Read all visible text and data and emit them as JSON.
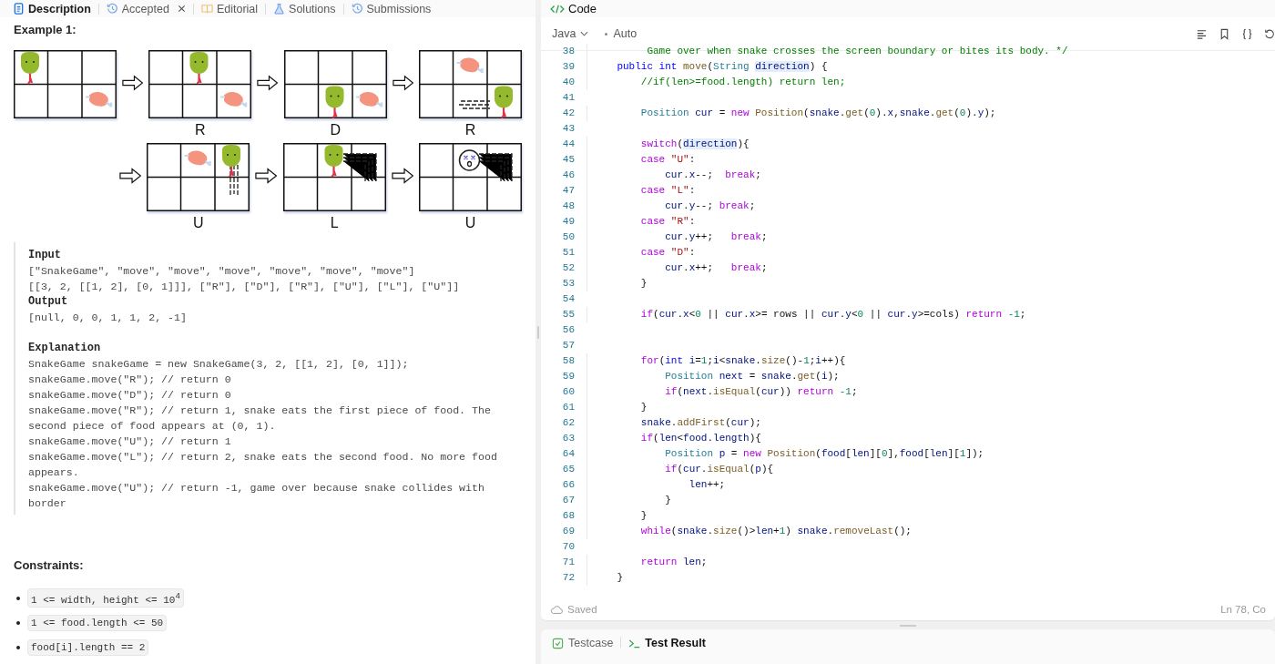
{
  "tabs": [
    {
      "label": "Description",
      "selected": true,
      "closable": false
    },
    {
      "label": "Accepted",
      "selected": false,
      "closable": true
    },
    {
      "label": "Editorial",
      "selected": false,
      "closable": false
    },
    {
      "label": "Solutions",
      "selected": false,
      "closable": false
    },
    {
      "label": "Submissions",
      "selected": false,
      "closable": false
    }
  ],
  "example": {
    "title": "Example 1:",
    "moves": [
      "R",
      "D",
      "R",
      "U",
      "L",
      "U"
    ],
    "blocks": [
      {
        "kind": "heading",
        "text": "Input"
      },
      {
        "kind": "line",
        "text": "[\"SnakeGame\", \"move\", \"move\", \"move\", \"move\", \"move\", \"move\"]"
      },
      {
        "kind": "line",
        "text": "[[3, 2, [[1, 2], [0, 1]]], [\"R\"], [\"D\"], [\"R\"], [\"U\"], [\"L\"], [\"U\"]]"
      },
      {
        "kind": "heading",
        "text": "Output"
      },
      {
        "kind": "line",
        "text": "[null, 0, 0, 1, 1, 2, -1]"
      },
      {
        "kind": "gap"
      },
      {
        "kind": "heading",
        "text": "Explanation"
      },
      {
        "kind": "line",
        "text": "SnakeGame snakeGame = new SnakeGame(3, 2, [[1, 2], [0, 1]]);"
      },
      {
        "kind": "line",
        "text": "snakeGame.move(\"R\"); // return 0"
      },
      {
        "kind": "line",
        "text": "snakeGame.move(\"D\"); // return 0"
      },
      {
        "kind": "line",
        "text": "snakeGame.move(\"R\"); // return 1, snake eats the first piece of food. The second piece of food appears at (0, 1)."
      },
      {
        "kind": "line",
        "text": "snakeGame.move(\"U\"); // return 1"
      },
      {
        "kind": "line",
        "text": "snakeGame.move(\"L\"); // return 2, snake eats the second food. No more food appears."
      },
      {
        "kind": "line",
        "text": "snakeGame.move(\"U\"); // return -1, game over because snake collides with border"
      }
    ]
  },
  "constraints": {
    "title": "Constraints:",
    "items": [
      "1 <= width, height <= 10$^{4}$",
      "1 <= food.length <= 50",
      "food[i].length == 2"
    ]
  },
  "editor": {
    "title": "Code",
    "language": "Java",
    "mode": "Auto",
    "status": "Saved",
    "position": "Ln 78, Co",
    "lines": [
      {
        "n": "38",
        "tokens": [
          {
            "kind": "cmt",
            "text": "         Game over when snake crosses the screen boundary or bites its body. */"
          }
        ]
      },
      {
        "n": "39",
        "tokens": [
          {
            "kind": "decl",
            "text": "    public"
          },
          {
            "kind": "decl",
            "text": " int"
          },
          {
            "kind": "fn",
            "text": " move"
          },
          {
            "kind": "plain",
            "text": "("
          },
          {
            "kind": "type",
            "text": "String "
          },
          {
            "kind": "hl",
            "text": "direction"
          },
          {
            "kind": "plain",
            "text": ") {"
          }
        ]
      },
      {
        "n": "40",
        "tokens": [
          {
            "kind": "cmt",
            "text": "        //if(len>=food.length) return len;"
          }
        ]
      },
      {
        "n": "41"
      },
      {
        "n": "42",
        "tokens": [
          {
            "kind": "type",
            "text": "        Position"
          },
          {
            "kind": "var",
            "text": " cur"
          },
          {
            "kind": "plain",
            "text": " = "
          },
          {
            "kind": "kw",
            "text": "new"
          },
          {
            "kind": "fn",
            "text": " Position"
          },
          {
            "kind": "plain",
            "text": "("
          },
          {
            "kind": "var",
            "text": "snake"
          },
          {
            "kind": "plain",
            "text": "."
          },
          {
            "kind": "fn",
            "text": "get"
          },
          {
            "kind": "plain",
            "text": "("
          },
          {
            "kind": "num",
            "text": "0"
          },
          {
            "kind": "plain",
            "text": ")."
          },
          {
            "kind": "var",
            "text": "x"
          },
          {
            "kind": "plain",
            "text": ","
          },
          {
            "kind": "var",
            "text": "snake"
          },
          {
            "kind": "plain",
            "text": "."
          },
          {
            "kind": "fn",
            "text": "get"
          },
          {
            "kind": "plain",
            "text": "("
          },
          {
            "kind": "num",
            "text": "0"
          },
          {
            "kind": "plain",
            "text": ")."
          },
          {
            "kind": "var",
            "text": "y"
          },
          {
            "kind": "plain",
            "text": ");"
          }
        ]
      },
      {
        "n": "43"
      },
      {
        "n": "44",
        "tokens": [
          {
            "kind": "kw",
            "text": "        switch"
          },
          {
            "kind": "plain",
            "text": "("
          },
          {
            "kind": "hl",
            "text": "direction"
          },
          {
            "kind": "plain",
            "text": "){"
          }
        ]
      },
      {
        "n": "45",
        "tokens": [
          {
            "kind": "kw",
            "text": "        case"
          },
          {
            "kind": "str",
            "text": " \"U\""
          },
          {
            "kind": "plain",
            "text": ":"
          }
        ]
      },
      {
        "n": "46",
        "tokens": [
          {
            "kind": "var",
            "text": "            cur"
          },
          {
            "kind": "plain",
            "text": "."
          },
          {
            "kind": "var",
            "text": "x"
          },
          {
            "kind": "plain",
            "text": "--;"
          },
          {
            "kind": "kw",
            "text": "  break"
          },
          {
            "kind": "plain",
            "text": ";"
          }
        ]
      },
      {
        "n": "47",
        "tokens": [
          {
            "kind": "kw",
            "text": "        case"
          },
          {
            "kind": "str",
            "text": " \"L\""
          },
          {
            "kind": "plain",
            "text": ":"
          }
        ]
      },
      {
        "n": "48",
        "tokens": [
          {
            "kind": "var",
            "text": "            cur"
          },
          {
            "kind": "plain",
            "text": "."
          },
          {
            "kind": "var",
            "text": "y"
          },
          {
            "kind": "plain",
            "text": "--;"
          },
          {
            "kind": "kw",
            "text": " break"
          },
          {
            "kind": "plain",
            "text": ";"
          }
        ]
      },
      {
        "n": "49",
        "tokens": [
          {
            "kind": "kw",
            "text": "        case"
          },
          {
            "kind": "str",
            "text": " \"R\""
          },
          {
            "kind": "plain",
            "text": ":"
          }
        ]
      },
      {
        "n": "50",
        "tokens": [
          {
            "kind": "var",
            "text": "            cur"
          },
          {
            "kind": "plain",
            "text": "."
          },
          {
            "kind": "var",
            "text": "y"
          },
          {
            "kind": "plain",
            "text": "++;"
          },
          {
            "kind": "kw",
            "text": "   break"
          },
          {
            "kind": "plain",
            "text": ";"
          }
        ]
      },
      {
        "n": "51",
        "tokens": [
          {
            "kind": "kw",
            "text": "        case"
          },
          {
            "kind": "str",
            "text": " \"D\""
          },
          {
            "kind": "plain",
            "text": ":"
          }
        ]
      },
      {
        "n": "52",
        "tokens": [
          {
            "kind": "var",
            "text": "            cur"
          },
          {
            "kind": "plain",
            "text": "."
          },
          {
            "kind": "var",
            "text": "x"
          },
          {
            "kind": "plain",
            "text": "++;"
          },
          {
            "kind": "kw",
            "text": "   break"
          },
          {
            "kind": "plain",
            "text": ";"
          }
        ]
      },
      {
        "n": "53",
        "tokens": [
          {
            "kind": "plain",
            "text": "        }"
          }
        ]
      },
      {
        "n": "54"
      },
      {
        "n": "55",
        "tokens": [
          {
            "kind": "kw",
            "text": "        if"
          },
          {
            "kind": "plain",
            "text": "("
          },
          {
            "kind": "var",
            "text": "cur"
          },
          {
            "kind": "plain",
            "text": "."
          },
          {
            "kind": "var",
            "text": "x"
          },
          {
            "kind": "plain",
            "text": "<"
          },
          {
            "kind": "num",
            "text": "0"
          },
          {
            "kind": "plain",
            "text": " || "
          },
          {
            "kind": "var",
            "text": "cur"
          },
          {
            "kind": "plain",
            "text": "."
          },
          {
            "kind": "var",
            "text": "x"
          },
          {
            "kind": "plain",
            "text": ">= rows || "
          },
          {
            "kind": "var",
            "text": "cur"
          },
          {
            "kind": "plain",
            "text": "."
          },
          {
            "kind": "var",
            "text": "y"
          },
          {
            "kind": "plain",
            "text": "<"
          },
          {
            "kind": "num",
            "text": "0"
          },
          {
            "kind": "plain",
            "text": " || "
          },
          {
            "kind": "var",
            "text": "cur"
          },
          {
            "kind": "plain",
            "text": "."
          },
          {
            "kind": "var",
            "text": "y"
          },
          {
            "kind": "plain",
            "text": ">=cols) "
          },
          {
            "kind": "kw",
            "text": "return"
          },
          {
            "kind": "num",
            "text": " -1"
          },
          {
            "kind": "plain",
            "text": ";"
          }
        ]
      },
      {
        "n": "56"
      },
      {
        "n": "57"
      },
      {
        "n": "58",
        "tokens": [
          {
            "kind": "kw",
            "text": "        for"
          },
          {
            "kind": "plain",
            "text": "("
          },
          {
            "kind": "decl",
            "text": "int"
          },
          {
            "kind": "var",
            "text": " i"
          },
          {
            "kind": "plain",
            "text": "="
          },
          {
            "kind": "num",
            "text": "1"
          },
          {
            "kind": "plain",
            "text": ";"
          },
          {
            "kind": "var",
            "text": "i"
          },
          {
            "kind": "plain",
            "text": "<"
          },
          {
            "kind": "var",
            "text": "snake"
          },
          {
            "kind": "plain",
            "text": "."
          },
          {
            "kind": "fn",
            "text": "size"
          },
          {
            "kind": "plain",
            "text": "()-"
          },
          {
            "kind": "num",
            "text": "1"
          },
          {
            "kind": "plain",
            "text": ";"
          },
          {
            "kind": "var",
            "text": "i"
          },
          {
            "kind": "plain",
            "text": "++){"
          }
        ]
      },
      {
        "n": "59",
        "tokens": [
          {
            "kind": "type",
            "text": "            Position"
          },
          {
            "kind": "var",
            "text": " next"
          },
          {
            "kind": "plain",
            "text": " = "
          },
          {
            "kind": "var",
            "text": "snake"
          },
          {
            "kind": "plain",
            "text": "."
          },
          {
            "kind": "fn",
            "text": "get"
          },
          {
            "kind": "plain",
            "text": "("
          },
          {
            "kind": "var",
            "text": "i"
          },
          {
            "kind": "plain",
            "text": ");"
          }
        ]
      },
      {
        "n": "60",
        "tokens": [
          {
            "kind": "kw",
            "text": "            if"
          },
          {
            "kind": "plain",
            "text": "("
          },
          {
            "kind": "var",
            "text": "next"
          },
          {
            "kind": "plain",
            "text": "."
          },
          {
            "kind": "fn",
            "text": "isEqual"
          },
          {
            "kind": "plain",
            "text": "("
          },
          {
            "kind": "var",
            "text": "cur"
          },
          {
            "kind": "plain",
            "text": ")) "
          },
          {
            "kind": "kw",
            "text": "return"
          },
          {
            "kind": "num",
            "text": " -1"
          },
          {
            "kind": "plain",
            "text": ";"
          }
        ]
      },
      {
        "n": "61",
        "tokens": [
          {
            "kind": "plain",
            "text": "        }"
          }
        ]
      },
      {
        "n": "62",
        "tokens": [
          {
            "kind": "var",
            "text": "        snake"
          },
          {
            "kind": "plain",
            "text": "."
          },
          {
            "kind": "fn",
            "text": "addFirst"
          },
          {
            "kind": "plain",
            "text": "("
          },
          {
            "kind": "var",
            "text": "cur"
          },
          {
            "kind": "plain",
            "text": ");"
          }
        ]
      },
      {
        "n": "63",
        "tokens": [
          {
            "kind": "kw",
            "text": "        if"
          },
          {
            "kind": "plain",
            "text": "("
          },
          {
            "kind": "var",
            "text": "len"
          },
          {
            "kind": "plain",
            "text": "<"
          },
          {
            "kind": "var",
            "text": "food"
          },
          {
            "kind": "plain",
            "text": "."
          },
          {
            "kind": "var",
            "text": "length"
          },
          {
            "kind": "plain",
            "text": "){"
          }
        ]
      },
      {
        "n": "64",
        "tokens": [
          {
            "kind": "type",
            "text": "            Position"
          },
          {
            "kind": "var",
            "text": " p"
          },
          {
            "kind": "plain",
            "text": " = "
          },
          {
            "kind": "kw",
            "text": "new"
          },
          {
            "kind": "fn",
            "text": " Position"
          },
          {
            "kind": "plain",
            "text": "("
          },
          {
            "kind": "var",
            "text": "food"
          },
          {
            "kind": "plain",
            "text": "["
          },
          {
            "kind": "var",
            "text": "len"
          },
          {
            "kind": "plain",
            "text": "]["
          },
          {
            "kind": "num",
            "text": "0"
          },
          {
            "kind": "plain",
            "text": "],"
          },
          {
            "kind": "var",
            "text": "food"
          },
          {
            "kind": "plain",
            "text": "["
          },
          {
            "kind": "var",
            "text": "len"
          },
          {
            "kind": "plain",
            "text": "]["
          },
          {
            "kind": "num",
            "text": "1"
          },
          {
            "kind": "plain",
            "text": "]);"
          }
        ]
      },
      {
        "n": "65",
        "tokens": [
          {
            "kind": "kw",
            "text": "            if"
          },
          {
            "kind": "plain",
            "text": "("
          },
          {
            "kind": "var",
            "text": "cur"
          },
          {
            "kind": "plain",
            "text": "."
          },
          {
            "kind": "fn",
            "text": "isEqual"
          },
          {
            "kind": "plain",
            "text": "("
          },
          {
            "kind": "var",
            "text": "p"
          },
          {
            "kind": "plain",
            "text": "){"
          }
        ]
      },
      {
        "n": "66",
        "tokens": [
          {
            "kind": "var",
            "text": "                len"
          },
          {
            "kind": "plain",
            "text": "++;"
          }
        ]
      },
      {
        "n": "67",
        "tokens": [
          {
            "kind": "plain",
            "text": "            }"
          }
        ]
      },
      {
        "n": "68",
        "tokens": [
          {
            "kind": "plain",
            "text": "        }"
          }
        ]
      },
      {
        "n": "69",
        "tokens": [
          {
            "kind": "kw",
            "text": "        while"
          },
          {
            "kind": "plain",
            "text": "("
          },
          {
            "kind": "var",
            "text": "snake"
          },
          {
            "kind": "plain",
            "text": "."
          },
          {
            "kind": "fn",
            "text": "size"
          },
          {
            "kind": "plain",
            "text": "()>"
          },
          {
            "kind": "var",
            "text": "len"
          },
          {
            "kind": "plain",
            "text": "+"
          },
          {
            "kind": "num",
            "text": "1"
          },
          {
            "kind": "plain",
            "text": ") "
          },
          {
            "kind": "var",
            "text": "snake"
          },
          {
            "kind": "plain",
            "text": "."
          },
          {
            "kind": "fn",
            "text": "removeLast"
          },
          {
            "kind": "plain",
            "text": "();"
          }
        ]
      },
      {
        "n": "70"
      },
      {
        "n": "71",
        "tokens": [
          {
            "kind": "kw",
            "text": "        return"
          },
          {
            "kind": "var",
            "text": " len"
          },
          {
            "kind": "plain",
            "text": ";"
          }
        ]
      },
      {
        "n": "72",
        "tokens": [
          {
            "kind": "plain",
            "text": "    }"
          }
        ]
      }
    ]
  },
  "bottom_tabs": [
    {
      "label": "Testcase",
      "selected": false
    },
    {
      "label": "Test Result",
      "selected": true
    }
  ]
}
